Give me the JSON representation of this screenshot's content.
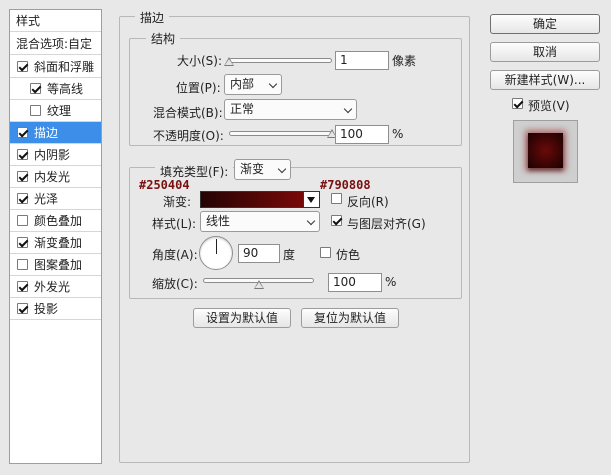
{
  "left_panel": {
    "title": "样式",
    "blend_options": "混合选项:自定",
    "items": [
      {
        "label": "斜面和浮雕",
        "checked": true,
        "sub": false,
        "selected": false
      },
      {
        "label": "等高线",
        "checked": true,
        "sub": true,
        "selected": false
      },
      {
        "label": "纹理",
        "checked": false,
        "sub": true,
        "selected": false
      },
      {
        "label": "描边",
        "checked": true,
        "sub": false,
        "selected": true
      },
      {
        "label": "内阴影",
        "checked": true,
        "sub": false,
        "selected": false
      },
      {
        "label": "内发光",
        "checked": true,
        "sub": false,
        "selected": false
      },
      {
        "label": "光泽",
        "checked": true,
        "sub": false,
        "selected": false
      },
      {
        "label": "颜色叠加",
        "checked": false,
        "sub": false,
        "selected": false
      },
      {
        "label": "渐变叠加",
        "checked": true,
        "sub": false,
        "selected": false
      },
      {
        "label": "图案叠加",
        "checked": false,
        "sub": false,
        "selected": false
      },
      {
        "label": "外发光",
        "checked": true,
        "sub": false,
        "selected": false
      },
      {
        "label": "投影",
        "checked": true,
        "sub": false,
        "selected": false
      }
    ]
  },
  "stroke": {
    "title": "描边",
    "structure": {
      "title": "结构",
      "size_label": "大小(S):",
      "size_value": "1",
      "size_unit": "像素",
      "size_fraction": 0.0,
      "position_label": "位置(P):",
      "position_value": "内部",
      "blend_mode_label": "混合模式(B):",
      "blend_mode_value": "正常",
      "opacity_label": "不透明度(O):",
      "opacity_value": "100",
      "opacity_unit": "%",
      "opacity_fraction": 1.0
    },
    "fill": {
      "fill_type_label": "填充类型(F):",
      "fill_type_value": "渐变",
      "color_start": "#250404",
      "color_end": "#790808",
      "gradient_label": "渐变:",
      "reverse_label": "反向(R)",
      "reverse_checked": false,
      "style_label": "样式(L):",
      "style_value": "线性",
      "align_label": "与图层对齐(G)",
      "align_checked": true,
      "angle_label": "角度(A):",
      "angle_value": "90",
      "angle_unit": "度",
      "dither_label": "仿色",
      "dither_checked": false,
      "scale_label": "缩放(C):",
      "scale_value": "100",
      "scale_unit": "%",
      "scale_fraction": 0.5
    },
    "make_default": "设置为默认值",
    "reset_default": "复位为默认值"
  },
  "buttons": {
    "ok": "确定",
    "cancel": "取消",
    "new_style": "新建样式(W)...",
    "preview_label": "预览(V)",
    "preview_checked": true
  }
}
